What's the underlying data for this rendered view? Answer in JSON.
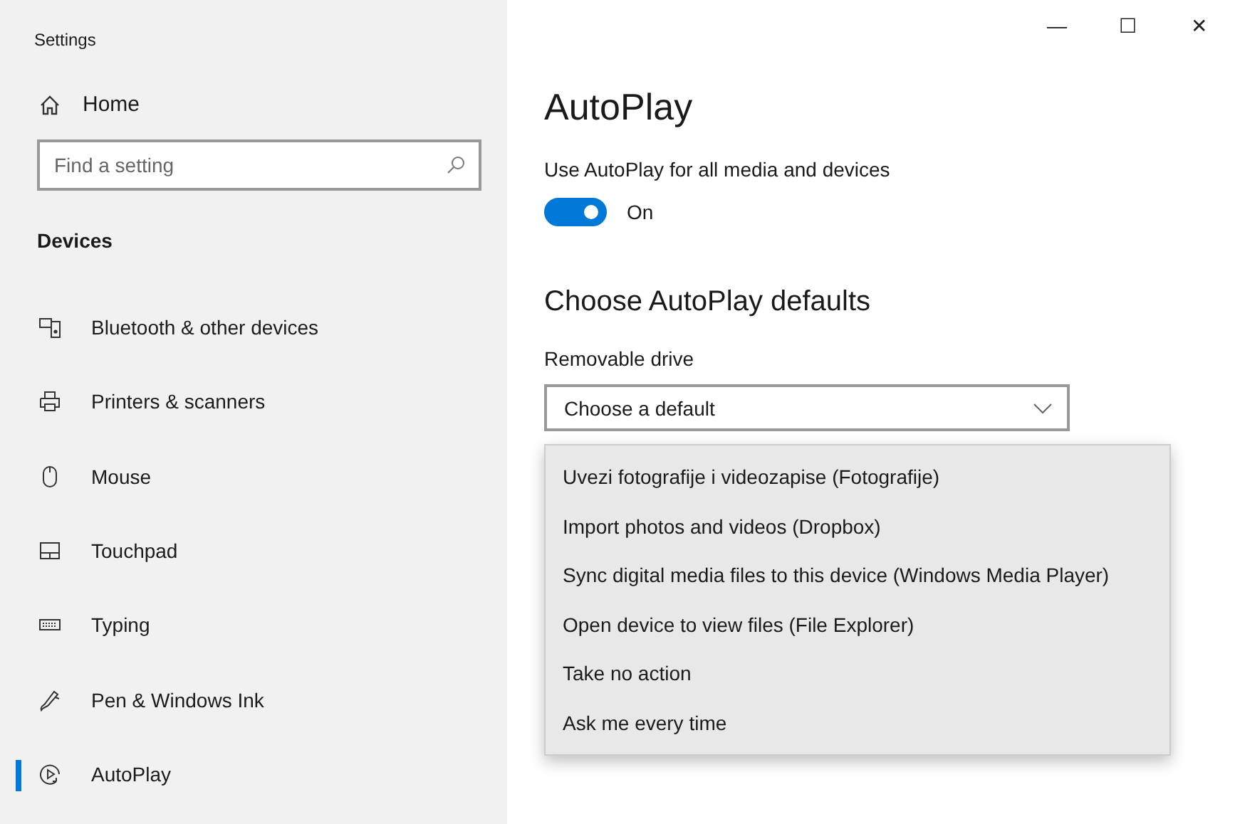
{
  "window": {
    "title": "Settings",
    "controls": [
      "—",
      "☐",
      "✕"
    ]
  },
  "sidebar": {
    "home": "Home",
    "search": {
      "placeholder": "Find a setting"
    },
    "section": "Devices",
    "items": [
      {
        "label": "Bluetooth & other devices",
        "selected": false
      },
      {
        "label": "Printers & scanners",
        "selected": false
      },
      {
        "label": "Mouse",
        "selected": false
      },
      {
        "label": "Touchpad",
        "selected": false
      },
      {
        "label": "Typing",
        "selected": false
      },
      {
        "label": "Pen & Windows Ink",
        "selected": false
      },
      {
        "label": "AutoPlay",
        "selected": true
      }
    ]
  },
  "main": {
    "title": "AutoPlay",
    "toggle": {
      "label": "Use AutoPlay for all media and devices",
      "on": true,
      "state": "On"
    },
    "section": "Choose AutoPlay defaults",
    "dropdown": {
      "label": "Removable drive",
      "value": "Choose a default",
      "expanded": true,
      "options": [
        "Uvezi fotografije i videozapise (Fotografije)",
        "Import photos and videos (Dropbox)",
        "Sync digital media files to this device (Windows Media Player)",
        "Open device to view files (File Explorer)",
        "Take no action",
        "Ask me every time"
      ]
    }
  }
}
